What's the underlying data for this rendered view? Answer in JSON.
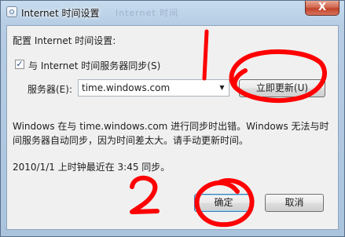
{
  "window": {
    "title": "Internet 时间设置",
    "ghost_title": "Internet 时间",
    "close_label": "X"
  },
  "dialog": {
    "heading": "配置 Internet 时间设置:",
    "sync_checkbox": {
      "label": "与 Internet 时间服务器同步(S)",
      "checked": true,
      "check_glyph": "✓"
    },
    "server_label": "服务器(E):",
    "server_value": "time.windows.com",
    "dropdown_glyph": "▼",
    "update_button": "立即更新(U)",
    "error_line1": "Windows 在与 time.windows.com 进行同步时出错。Windows 无法与时",
    "error_line2": "间服务器自动同步，因为时间差太大。请手动更新时间。",
    "last_sync": "2010/1/1 上时钟最近在 3:45 同步。",
    "ok_button": "确定",
    "cancel_button": "取消"
  },
  "annotations": {
    "step1_number": "1",
    "step2_number": "2",
    "ink_color": "#ff0000"
  }
}
